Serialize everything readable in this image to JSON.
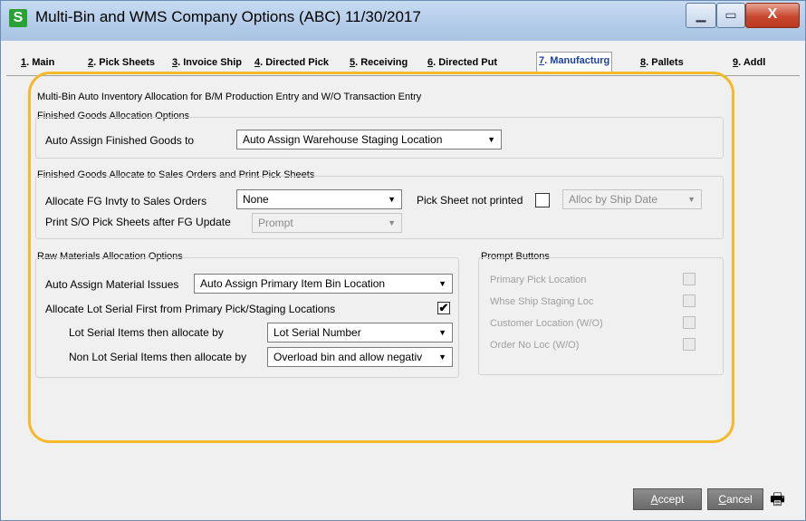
{
  "window": {
    "title": "Multi-Bin and WMS Company Options (ABC) 11/30/2017",
    "logo": "S"
  },
  "titlebar_icons": {
    "minimize": "minimize-icon",
    "maximize": "maximize-icon",
    "close": "close-icon",
    "close_glyph": "X"
  },
  "tabs": [
    {
      "key": "1",
      "label": ". Main"
    },
    {
      "key": "2",
      "label": ". Pick Sheets"
    },
    {
      "key": "3",
      "label": ". Invoice Ship"
    },
    {
      "key": "4",
      "label": ". Directed Pick"
    },
    {
      "key": "5",
      "label": ". Receiving"
    },
    {
      "key": "6",
      "label": ". Directed Put"
    },
    {
      "key": "7",
      "label": ". Manufacturg"
    },
    {
      "key": "8",
      "label": ". Pallets"
    },
    {
      "key": "9",
      "label": ". Addl"
    }
  ],
  "main": {
    "heading": "Multi-Bin Auto Inventory Allocation for B/M Production Entry and W/O Transaction Entry",
    "finished_goods": {
      "title": "Finished Goods Allocation Options",
      "auto_assign_label": "Auto Assign Finished Goods to",
      "auto_assign_value": "Auto Assign Warehouse Staging Location"
    },
    "fg_sales": {
      "title": "Finished Goods Allocate to Sales Orders and Print Pick Sheets",
      "allocate_label": "Allocate FG Invty to Sales Orders",
      "allocate_value": "None",
      "print_label": "Print S/O Pick Sheets after FG Update",
      "print_value": "Prompt",
      "pick_sheet_label": "Pick Sheet not printed",
      "alloc_value": "Alloc by Ship Date"
    },
    "raw_materials": {
      "title": "Raw Materials Allocation Options",
      "auto_assign_label": "Auto Assign Material Issues",
      "auto_assign_value": "Auto Assign Primary Item Bin Location",
      "lot_first_label": "Allocate Lot Serial First from Primary Pick/Staging Locations",
      "lot_first_check": "✔",
      "lot_items_label": "Lot Serial Items then allocate by",
      "lot_items_value": "Lot Serial Number",
      "non_lot_label": "Non Lot Serial Items then allocate by",
      "non_lot_value": "Overload bin and allow negativ"
    },
    "prompt_buttons": {
      "title": "Prompt Buttons",
      "items": [
        {
          "label": "Primary Pick Location"
        },
        {
          "label": "Whse Ship Staging Loc"
        },
        {
          "label": "Customer Location (W/O)"
        },
        {
          "label": "Order No Loc (W/O)"
        }
      ]
    }
  },
  "footer": {
    "accept": {
      "hotkey": "A",
      "rest": "ccept"
    },
    "cancel": {
      "hotkey": "C",
      "rest": "ancel"
    },
    "print_glyph": "🖶"
  },
  "dropdown_glyph": "▼",
  "colors": {
    "highlight": "#f5b92a",
    "active_tab": "#1a3fa8",
    "logo": "#2aa134"
  }
}
